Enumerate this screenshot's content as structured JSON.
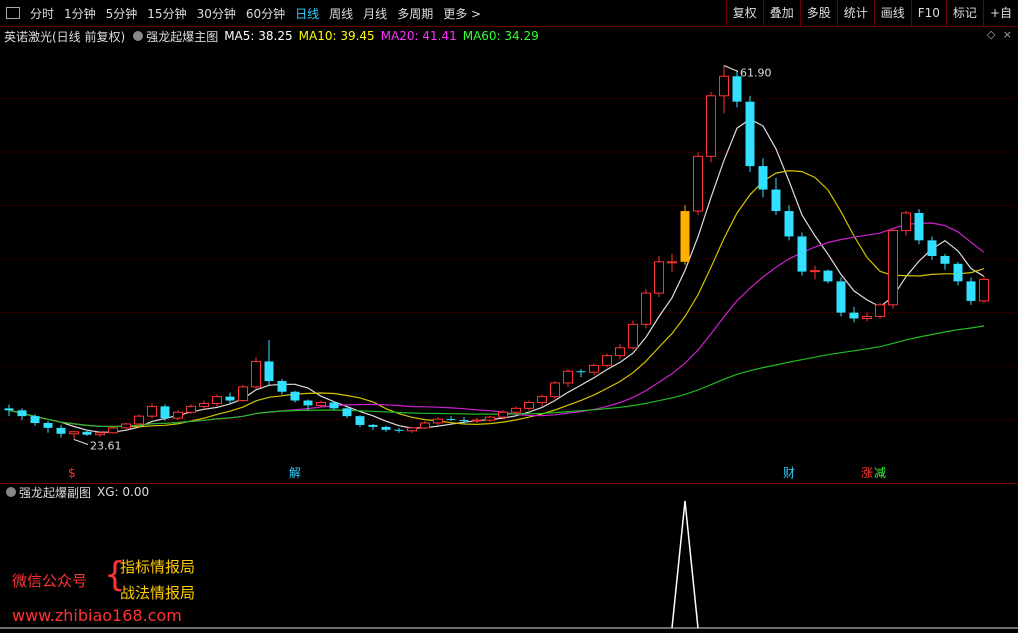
{
  "toolbar": {
    "periods": [
      "分时",
      "1分钟",
      "5分钟",
      "15分钟",
      "30分钟",
      "60分钟",
      "日线",
      "周线",
      "月线",
      "多周期",
      "更多 >"
    ],
    "active_period": "日线",
    "tools": [
      "复权",
      "叠加",
      "多股",
      "统计",
      "画线",
      "F10",
      "标记",
      "+自"
    ]
  },
  "main": {
    "stock": "英诺激光(日线 前复权)",
    "indicator": "强龙起爆主图",
    "ma": [
      {
        "label": "MA5: 38.25",
        "color": "#ffffff"
      },
      {
        "label": "MA10: 39.45",
        "color": "#ffff00"
      },
      {
        "label": "MA20: 41.41",
        "color": "#ff33ff"
      },
      {
        "label": "MA60: 34.29",
        "color": "#33ff33"
      }
    ],
    "high_label": "61.90",
    "low_label": "23.61",
    "markers": [
      {
        "text": "$",
        "color": "#ff3333",
        "day": 5
      },
      {
        "text": "解",
        "color": "#33ccff",
        "day": 22
      },
      {
        "text": "财",
        "color": "#33ccff",
        "day": 60
      },
      {
        "text": "涨",
        "color": "#ff3333",
        "day": 66
      },
      {
        "text": "减",
        "color": "#33ff33",
        "day": 67
      }
    ]
  },
  "sub": {
    "indicator": "强龙起爆副图",
    "xg": "XG: 0.00"
  },
  "watermark": {
    "line1": "微信公众号",
    "line2": "指标情报局",
    "line3": "战法情报局",
    "line4": "www.zhibiao168.com"
  },
  "chart_data": {
    "type": "candlestick",
    "y_range": [
      21,
      64
    ],
    "candles": [
      [
        26.8,
        27.2,
        26.0,
        26.6
      ],
      [
        26.6,
        26.8,
        25.6,
        26.0
      ],
      [
        26.0,
        26.2,
        25.0,
        25.3
      ],
      [
        25.3,
        25.5,
        24.3,
        24.8
      ],
      [
        24.8,
        25.1,
        23.8,
        24.2
      ],
      [
        24.2,
        24.5,
        23.61,
        24.4
      ],
      [
        24.4,
        24.6,
        24.0,
        24.1
      ],
      [
        24.1,
        24.4,
        23.9,
        24.3
      ],
      [
        24.3,
        24.9,
        24.2,
        24.8
      ],
      [
        24.8,
        25.3,
        24.7,
        25.2
      ],
      [
        25.2,
        26.2,
        25.0,
        26.0
      ],
      [
        26.0,
        27.3,
        25.8,
        27.0
      ],
      [
        27.0,
        27.2,
        25.5,
        25.8
      ],
      [
        25.8,
        26.6,
        25.6,
        26.4
      ],
      [
        26.4,
        27.2,
        26.2,
        27.0
      ],
      [
        27.0,
        27.6,
        26.7,
        27.3
      ],
      [
        27.3,
        28.2,
        27.0,
        28.0
      ],
      [
        28.0,
        28.4,
        27.2,
        27.6
      ],
      [
        27.6,
        29.2,
        27.5,
        29.0
      ],
      [
        29.0,
        32.0,
        28.8,
        31.6
      ],
      [
        31.6,
        33.8,
        29.2,
        29.6
      ],
      [
        29.6,
        29.8,
        28.2,
        28.5
      ],
      [
        28.5,
        28.6,
        27.4,
        27.6
      ],
      [
        27.6,
        27.7,
        26.6,
        27.1
      ],
      [
        27.1,
        27.6,
        26.9,
        27.4
      ],
      [
        27.4,
        27.5,
        26.6,
        26.8
      ],
      [
        26.8,
        26.9,
        25.8,
        26.0
      ],
      [
        26.0,
        26.1,
        24.9,
        25.1
      ],
      [
        25.1,
        25.2,
        24.6,
        24.9
      ],
      [
        24.9,
        25.0,
        24.4,
        24.6
      ],
      [
        24.6,
        24.8,
        24.3,
        24.5
      ],
      [
        24.5,
        24.9,
        24.3,
        24.8
      ],
      [
        24.8,
        25.5,
        24.7,
        25.3
      ],
      [
        25.3,
        25.9,
        25.1,
        25.7
      ],
      [
        25.7,
        26.0,
        25.5,
        25.6
      ],
      [
        25.6,
        25.9,
        25.2,
        25.5
      ],
      [
        25.5,
        25.8,
        25.3,
        25.6
      ],
      [
        25.6,
        26.0,
        25.4,
        25.9
      ],
      [
        25.9,
        26.6,
        25.7,
        26.4
      ],
      [
        26.4,
        27.0,
        26.2,
        26.8
      ],
      [
        26.8,
        27.6,
        26.6,
        27.4
      ],
      [
        27.4,
        28.2,
        27.0,
        28.0
      ],
      [
        28.0,
        29.6,
        27.8,
        29.4
      ],
      [
        29.4,
        30.8,
        29.0,
        30.6
      ],
      [
        30.6,
        30.8,
        30.0,
        30.5
      ],
      [
        30.5,
        31.4,
        30.2,
        31.2
      ],
      [
        31.2,
        32.4,
        31.0,
        32.2
      ],
      [
        32.2,
        33.4,
        31.8,
        33.0
      ],
      [
        33.0,
        35.8,
        32.8,
        35.4
      ],
      [
        35.4,
        39.0,
        35.0,
        38.6
      ],
      [
        38.6,
        42.4,
        38.2,
        41.8
      ],
      [
        41.8,
        42.6,
        40.8,
        41.8
      ],
      [
        41.8,
        47.6,
        41.5,
        47.0
      ],
      [
        47.0,
        53.0,
        46.6,
        52.6
      ],
      [
        52.6,
        59.2,
        52.0,
        58.8
      ],
      [
        58.8,
        61.9,
        57.0,
        60.8
      ],
      [
        60.8,
        61.4,
        57.6,
        58.2
      ],
      [
        58.2,
        58.8,
        51.0,
        51.6
      ],
      [
        51.6,
        52.4,
        48.4,
        49.2
      ],
      [
        49.2,
        50.4,
        46.6,
        47.0
      ],
      [
        47.0,
        47.6,
        44.0,
        44.4
      ],
      [
        44.4,
        44.8,
        40.4,
        40.8
      ],
      [
        40.8,
        41.4,
        40.0,
        40.9
      ],
      [
        40.9,
        41.0,
        39.6,
        39.8
      ],
      [
        39.8,
        40.2,
        36.2,
        36.6
      ],
      [
        36.6,
        37.2,
        35.6,
        36.0
      ],
      [
        36.0,
        36.6,
        35.7,
        36.2
      ],
      [
        36.2,
        37.6,
        36.0,
        37.4
      ],
      [
        37.4,
        45.2,
        37.0,
        45.0
      ],
      [
        45.0,
        47.0,
        44.5,
        46.8
      ],
      [
        46.8,
        47.2,
        43.6,
        44.0
      ],
      [
        44.0,
        44.4,
        42.0,
        42.4
      ],
      [
        42.4,
        42.6,
        41.0,
        41.6
      ],
      [
        41.6,
        41.8,
        39.4,
        39.8
      ],
      [
        39.8,
        40.2,
        37.4,
        37.8
      ],
      [
        37.8,
        40.4,
        37.6,
        40.0
      ]
    ]
  }
}
